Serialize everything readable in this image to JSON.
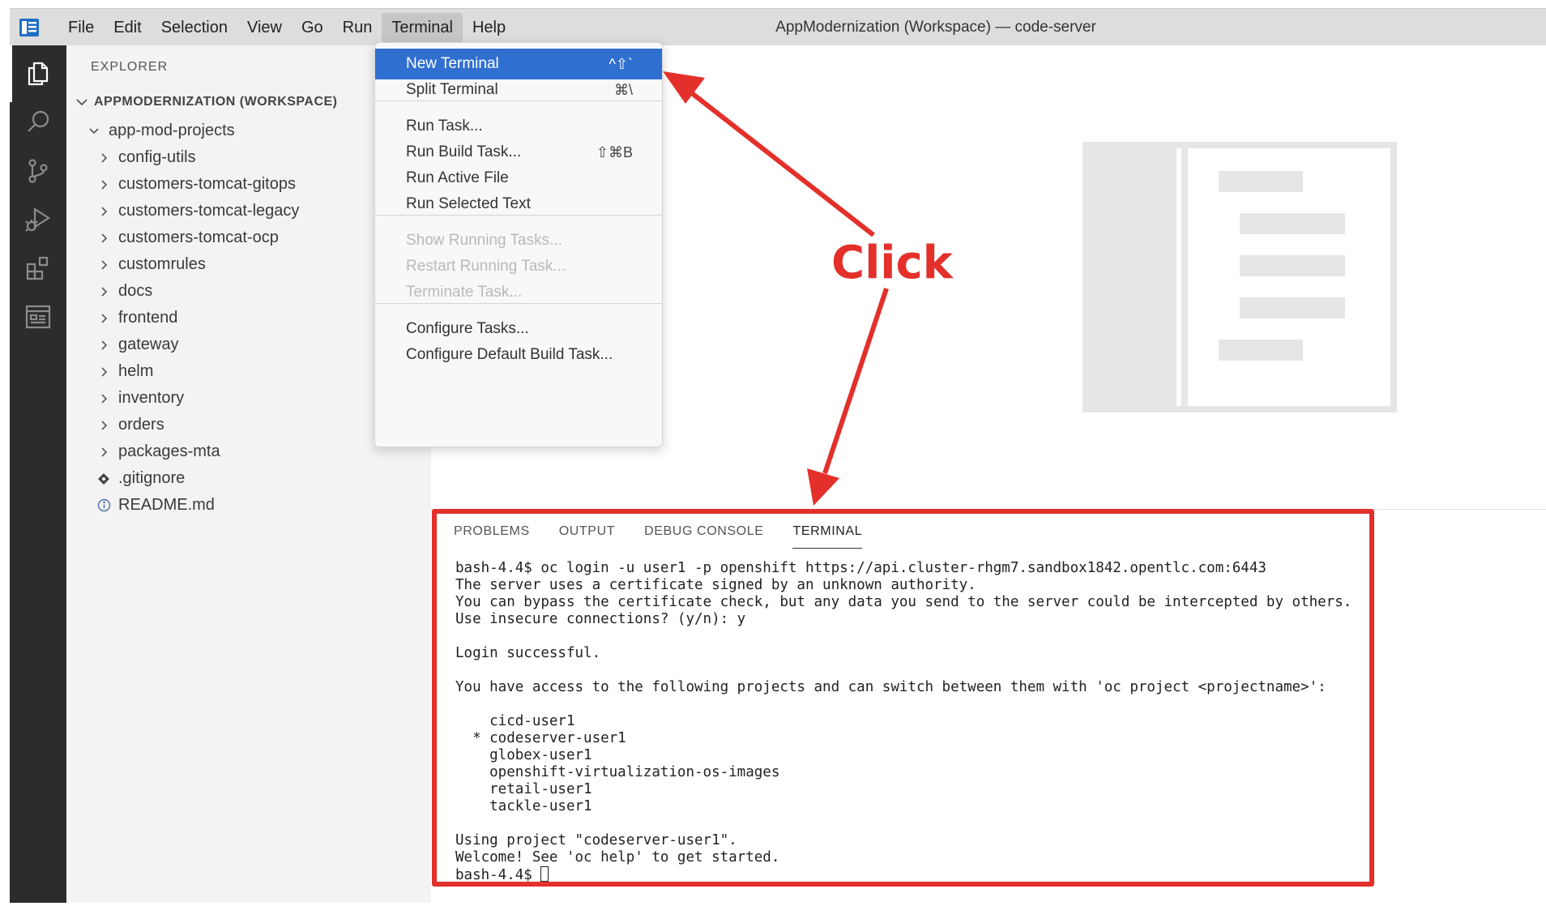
{
  "window": {
    "title": "AppModernization (Workspace) — code-server"
  },
  "menubar": {
    "items": [
      {
        "label": "File"
      },
      {
        "label": "Edit"
      },
      {
        "label": "Selection"
      },
      {
        "label": "View"
      },
      {
        "label": "Go"
      },
      {
        "label": "Run"
      },
      {
        "label": "Terminal"
      },
      {
        "label": "Help"
      }
    ],
    "active": "Terminal"
  },
  "activity_bar": {
    "icons": [
      "explorer-icon",
      "search-icon",
      "source-control-icon",
      "run-debug-icon",
      "extensions-icon",
      "remote-explorer-icon"
    ]
  },
  "explorer": {
    "title": "EXPLORER",
    "workspace": "APPMODERNIZATION (WORKSPACE)",
    "root_folder": "app-mod-projects",
    "folders": [
      "config-utils",
      "customers-tomcat-gitops",
      "customers-tomcat-legacy",
      "customers-tomcat-ocp",
      "customrules",
      "docs",
      "frontend",
      "gateway",
      "helm",
      "inventory",
      "orders",
      "packages-mta"
    ],
    "files": [
      {
        "name": ".gitignore",
        "icon": "git-diamond-icon"
      },
      {
        "name": "README.md",
        "icon": "info-icon"
      }
    ]
  },
  "terminal_menu": {
    "items": [
      {
        "label": "New Terminal",
        "shortcut": "^⇧`",
        "state": "selected"
      },
      {
        "label": "Split Terminal",
        "shortcut": "⌘\\",
        "state": "enabled"
      },
      {
        "label": "Run Task...",
        "shortcut": "",
        "state": "enabled"
      },
      {
        "label": "Run Build Task...",
        "shortcut": "⇧⌘B",
        "state": "enabled"
      },
      {
        "label": "Run Active File",
        "shortcut": "",
        "state": "enabled"
      },
      {
        "label": "Run Selected Text",
        "shortcut": "",
        "state": "enabled"
      },
      {
        "label": "Show Running Tasks...",
        "shortcut": "",
        "state": "disabled"
      },
      {
        "label": "Restart Running Task...",
        "shortcut": "",
        "state": "disabled"
      },
      {
        "label": "Terminate Task...",
        "shortcut": "",
        "state": "disabled"
      },
      {
        "label": "Configure Tasks...",
        "shortcut": "",
        "state": "enabled"
      },
      {
        "label": "Configure Default Build Task...",
        "shortcut": "",
        "state": "enabled"
      }
    ]
  },
  "panel": {
    "tabs": [
      "PROBLEMS",
      "OUTPUT",
      "DEBUG CONSOLE",
      "TERMINAL"
    ],
    "active_tab": "TERMINAL",
    "terminal_lines": [
      "bash-4.4$ oc login -u user1 -p openshift https://api.cluster-rhgm7.sandbox1842.opentlc.com:6443",
      "The server uses a certificate signed by an unknown authority.",
      "You can bypass the certificate check, but any data you send to the server could be intercepted by others.",
      "Use insecure connections? (y/n): y",
      "",
      "Login successful.",
      "",
      "You have access to the following projects and can switch between them with 'oc project <projectname>':",
      "",
      "    cicd-user1",
      "  * codeserver-user1",
      "    globex-user1",
      "    openshift-virtualization-os-images",
      "    retail-user1",
      "    tackle-user1",
      "",
      "Using project \"codeserver-user1\".",
      "Welcome! See 'oc help' to get started."
    ],
    "prompt": "bash-4.4$ "
  },
  "annotation": {
    "text": "Click",
    "color": "#e3302a"
  },
  "colors": {
    "menu_selected": "#2f6fcf",
    "activity_bar": "#2c2c2c",
    "sidebar": "#f3f3f3",
    "annotation": "#e3302a"
  }
}
